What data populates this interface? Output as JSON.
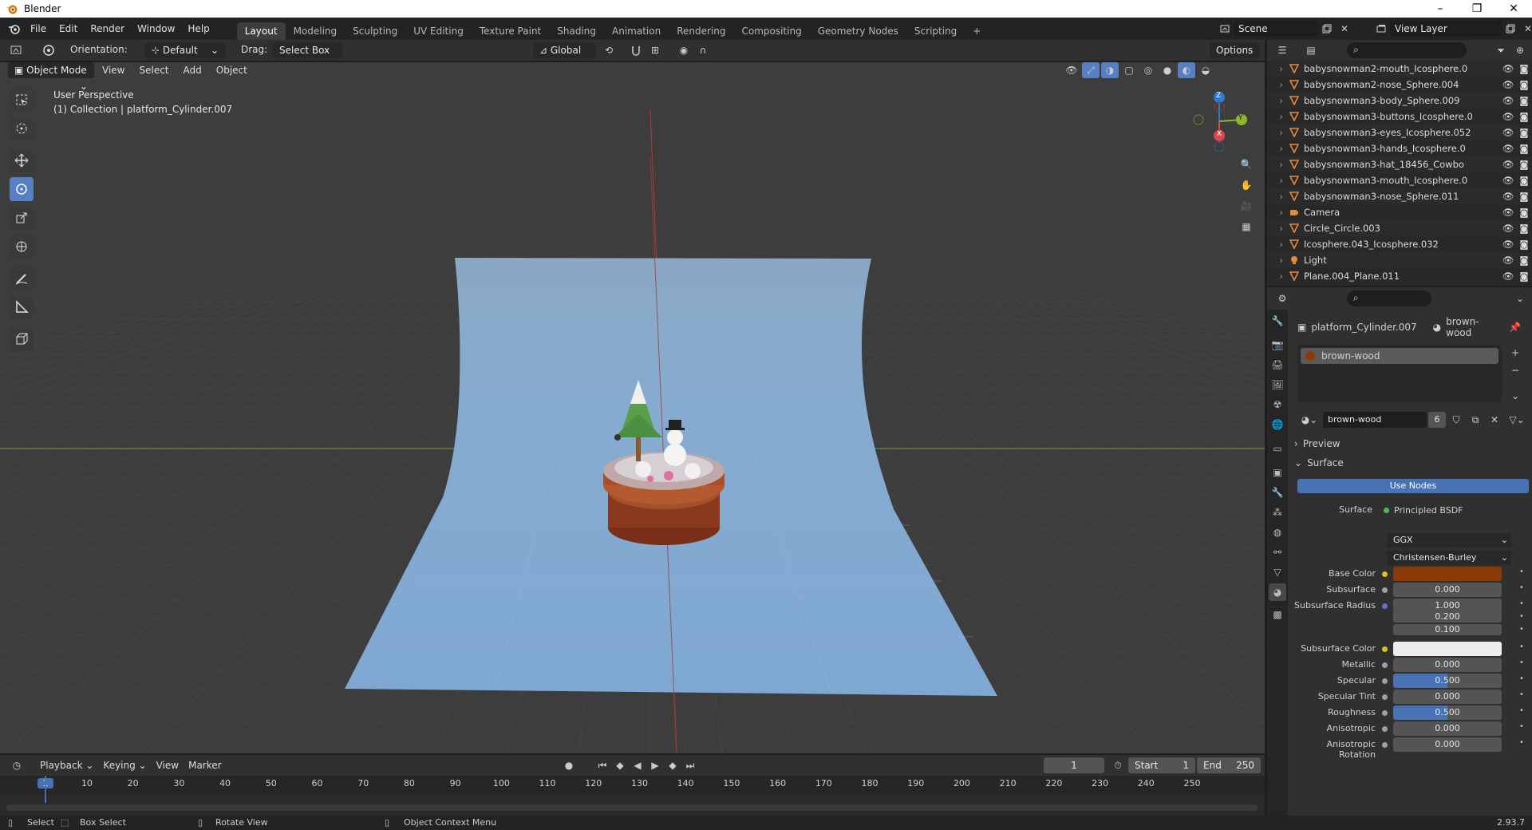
{
  "window": {
    "title": "Blender",
    "minimize": "–",
    "maximize": "❐",
    "close": "✕"
  },
  "menu": [
    "File",
    "Edit",
    "Render",
    "Window",
    "Help"
  ],
  "workspaces": [
    "Layout",
    "Modeling",
    "Sculpting",
    "UV Editing",
    "Texture Paint",
    "Shading",
    "Animation",
    "Rendering",
    "Compositing",
    "Geometry Nodes",
    "Scripting",
    "+"
  ],
  "active_workspace": "Layout",
  "scene": {
    "name": "Scene",
    "view_layer": "View Layer"
  },
  "viewport_header": {
    "orientation_label": "Orientation:",
    "orientation_value": "Default",
    "drag_label": "Drag:",
    "drag_value": "Select Box",
    "transform": "Global",
    "options": "Options",
    "mode": "Object Mode",
    "menus": [
      "View",
      "Select",
      "Add",
      "Object"
    ]
  },
  "viewport": {
    "perspective": "User Perspective",
    "collection": "(1) Collection | platform_Cylinder.007",
    "gizmo": {
      "z": "Z",
      "y": "Y",
      "x": "X"
    }
  },
  "outliner": {
    "items": [
      {
        "name": "babysnowman2-mouth_Icosphere.0",
        "type": "mesh"
      },
      {
        "name": "babysnowman2-nose_Sphere.004",
        "type": "mesh"
      },
      {
        "name": "babysnowman3-body_Sphere.009",
        "type": "mesh"
      },
      {
        "name": "babysnowman3-buttons_Icosphere.0",
        "type": "mesh"
      },
      {
        "name": "babysnowman3-eyes_Icosphere.052",
        "type": "mesh"
      },
      {
        "name": "babysnowman3-hands_Icosphere.0",
        "type": "mesh"
      },
      {
        "name": "babysnowman3-hat_18456_Cowbo",
        "type": "mesh"
      },
      {
        "name": "babysnowman3-mouth_Icosphere.0",
        "type": "mesh"
      },
      {
        "name": "babysnowman3-nose_Sphere.011",
        "type": "mesh"
      },
      {
        "name": "Camera",
        "type": "camera"
      },
      {
        "name": "Circle_Circle.003",
        "type": "mesh"
      },
      {
        "name": "Icosphere.043_Icosphere.032",
        "type": "mesh"
      },
      {
        "name": "Light",
        "type": "light"
      },
      {
        "name": "Plane.004_Plane.011",
        "type": "mesh"
      }
    ]
  },
  "properties": {
    "object": "platform_Cylinder.007",
    "material": "brown-wood",
    "slot": "brown-wood",
    "material_name": "brown-wood",
    "users": "6",
    "preview": "Preview",
    "surface_panel": "Surface",
    "use_nodes": "Use Nodes",
    "surface_label": "Surface",
    "surface_shader": "Principled BSDF",
    "distribution": "GGX",
    "subsurface_method": "Christensen-Burley",
    "fields": [
      {
        "label": "Base Color",
        "value": "",
        "color": "#8a3a06",
        "dot": "#d8c21b"
      },
      {
        "label": "Subsurface",
        "value": "0.000",
        "dot": "#a0a0a0"
      },
      {
        "label": "Subsurface Radius",
        "value": "1.000",
        "dot": "#6b6bd8"
      },
      {
        "label": "",
        "value": "0.200"
      },
      {
        "label": "",
        "value": "0.100"
      },
      {
        "label": "Subsurface Color",
        "value": "",
        "color": "#eeeeee",
        "dot": "#d8c21b"
      },
      {
        "label": "Metallic",
        "value": "0.000",
        "dot": "#a0a0a0"
      },
      {
        "label": "Specular",
        "value": "0.500",
        "dot": "#a0a0a0",
        "fill": 0.5
      },
      {
        "label": "Specular Tint",
        "value": "0.000",
        "dot": "#a0a0a0"
      },
      {
        "label": "Roughness",
        "value": "0.500",
        "dot": "#a0a0a0",
        "fill": 0.5
      },
      {
        "label": "Anisotropic",
        "value": "0.000",
        "dot": "#a0a0a0"
      },
      {
        "label": "Anisotropic Rotation",
        "value": "0.000",
        "dot": "#a0a0a0"
      }
    ]
  },
  "timeline": {
    "menus": [
      "Playback",
      "Keying",
      "View",
      "Marker"
    ],
    "current_frame": "1",
    "start_label": "Start",
    "start": "1",
    "end_label": "End",
    "end": "250",
    "ruler": [
      "1",
      "10",
      "20",
      "30",
      "40",
      "50",
      "60",
      "70",
      "80",
      "90",
      "100",
      "110",
      "120",
      "130",
      "140",
      "150",
      "160",
      "170",
      "180",
      "190",
      "200",
      "210",
      "220",
      "230",
      "240",
      "250"
    ]
  },
  "statusbar": {
    "select": "Select",
    "box_select": "Box Select",
    "rotate_view": "Rotate View",
    "context_menu": "Object Context Menu",
    "version": "2.93.7"
  },
  "colors": {
    "accent": "#5680c2",
    "mesh_icon": "#e8883a",
    "backdrop": "#82a8cc"
  }
}
